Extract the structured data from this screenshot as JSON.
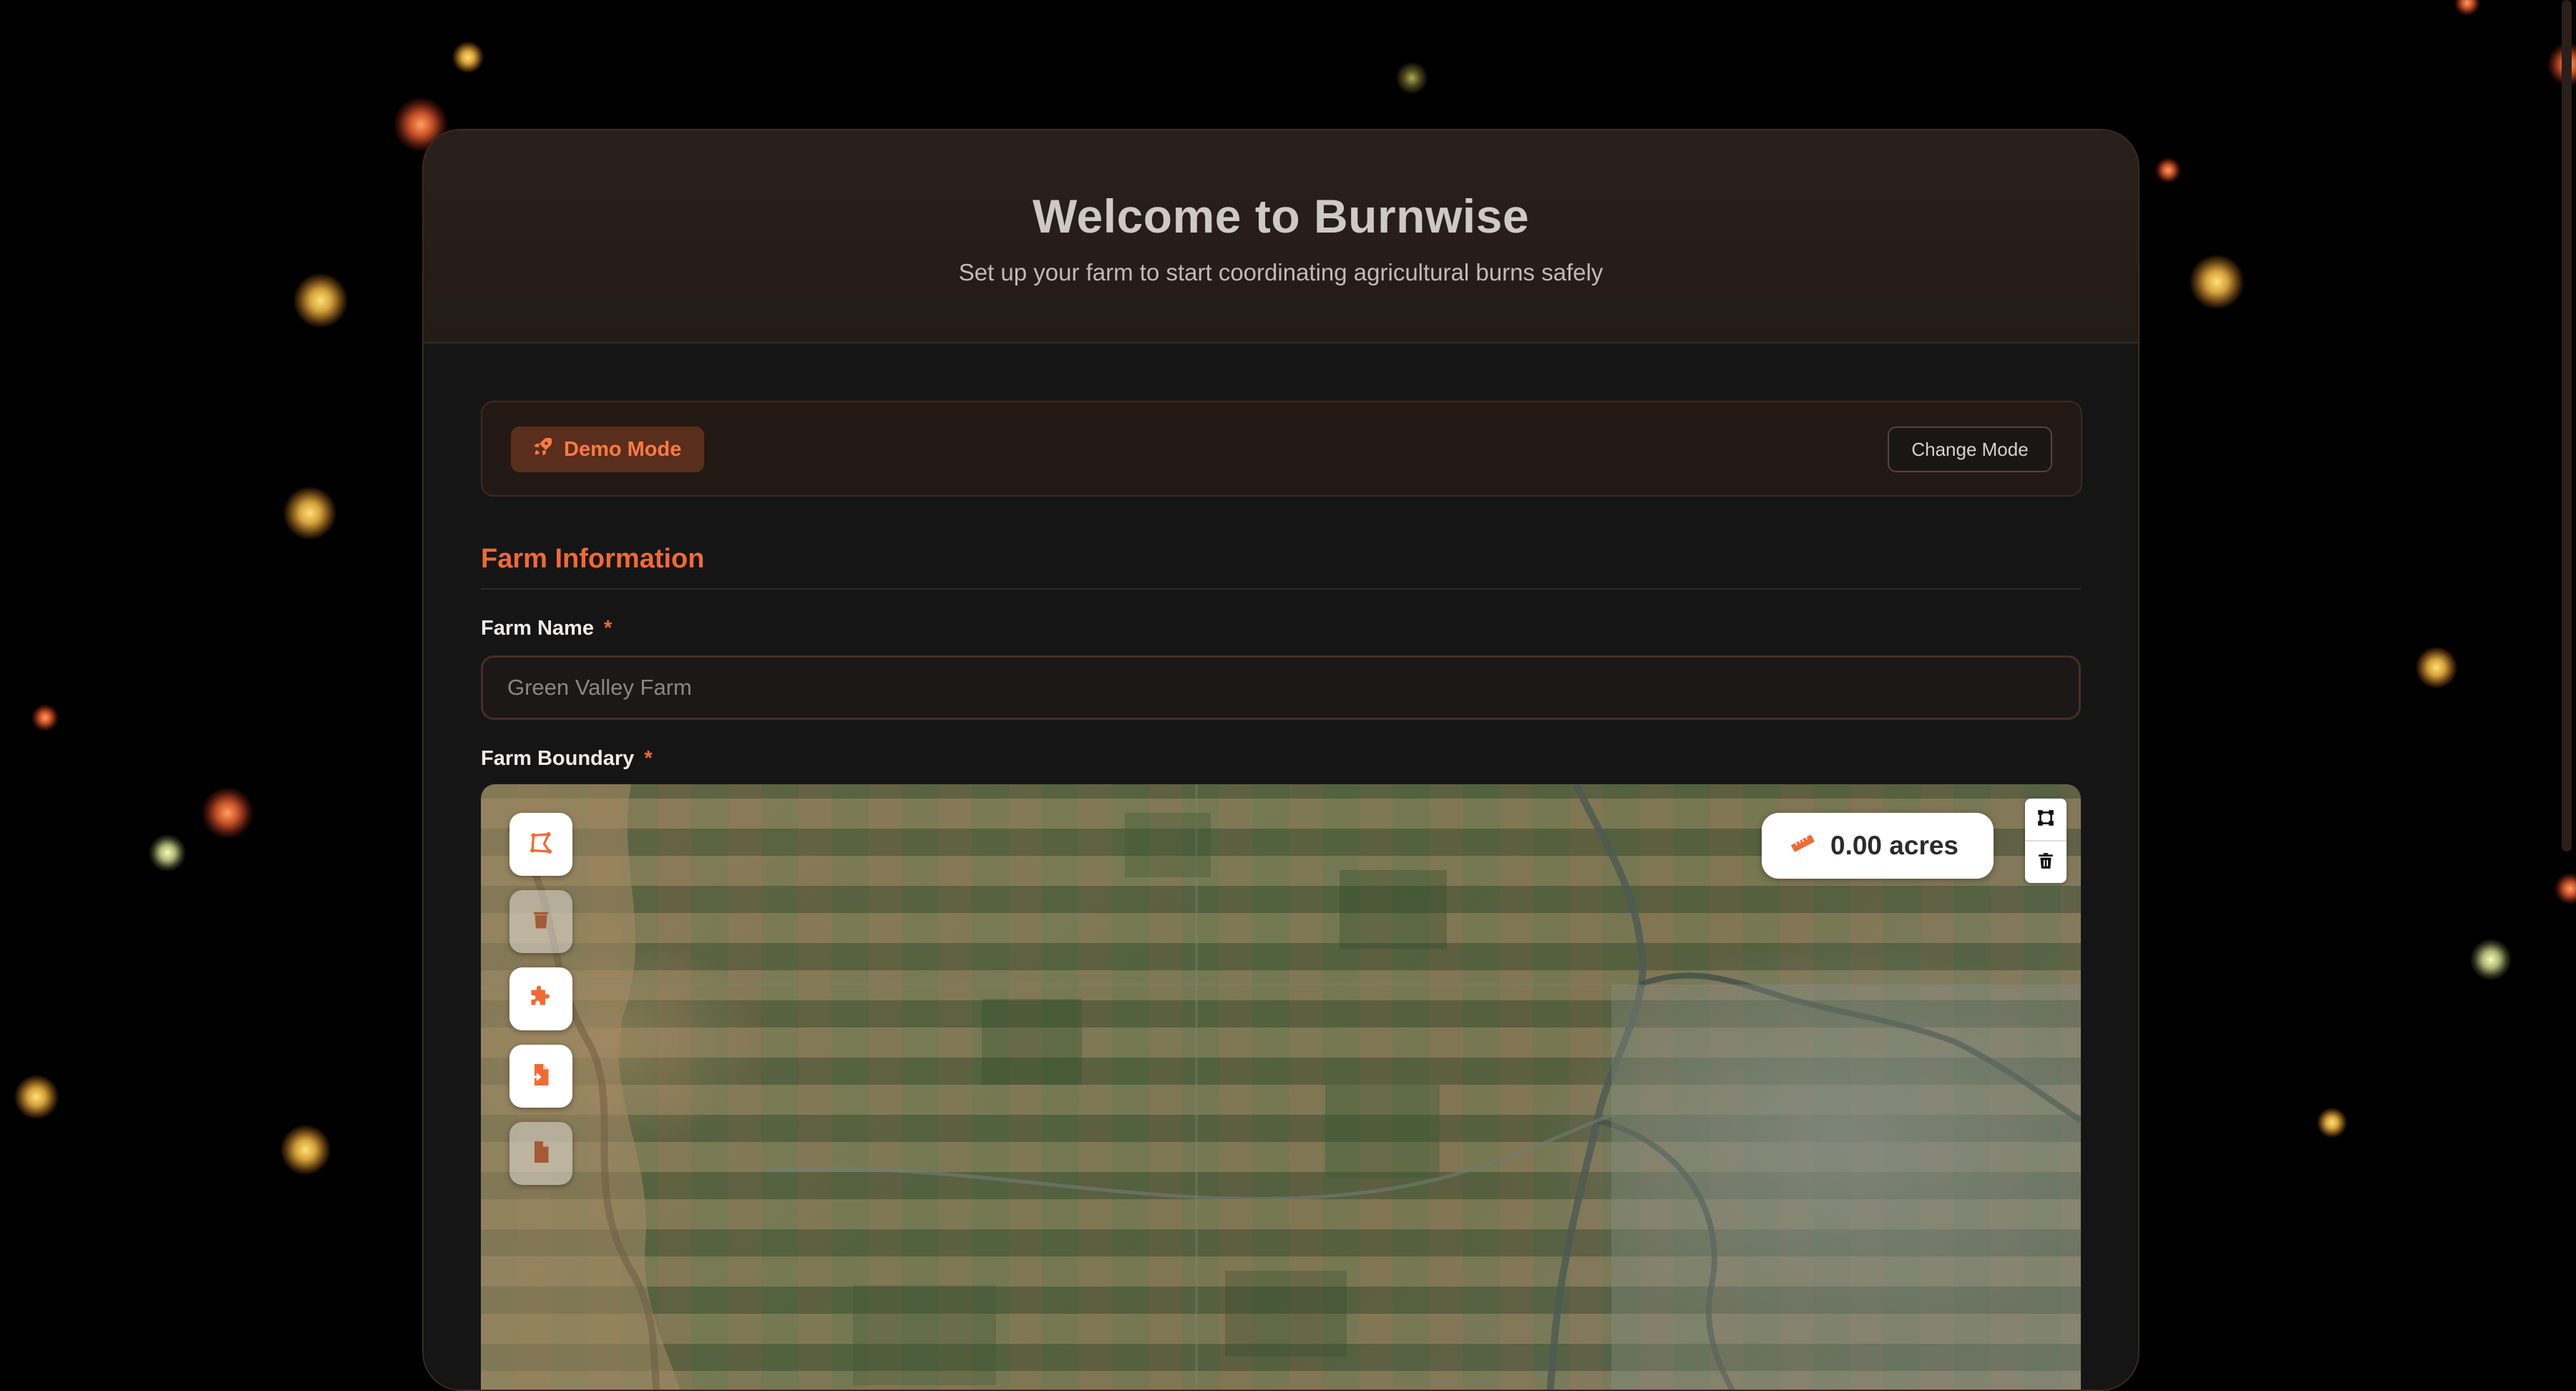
{
  "header": {
    "title": "Welcome to Burnwise",
    "subtitle": "Set up your farm to start coordinating agricultural burns safely"
  },
  "mode": {
    "badge_label": "Demo Mode",
    "badge_icon": "rocket-icon",
    "change_label": "Change Mode"
  },
  "section": {
    "title": "Farm Information"
  },
  "farm_name": {
    "label": "Farm Name",
    "required_mark": "*",
    "placeholder": "Green Valley Farm",
    "value": ""
  },
  "farm_boundary": {
    "label": "Farm Boundary",
    "required_mark": "*",
    "area_readout": "0.00 acres",
    "area_icon": "ruler-icon",
    "tools": [
      {
        "name": "draw-polygon-icon",
        "enabled": true
      },
      {
        "name": "delete-shape-icon",
        "enabled": false
      },
      {
        "name": "puzzle-icon",
        "enabled": true
      },
      {
        "name": "import-file-icon",
        "enabled": true
      },
      {
        "name": "export-file-icon",
        "enabled": false
      }
    ],
    "map_controls": [
      "draw-polygon-icon",
      "trash-icon"
    ]
  },
  "colors": {
    "accent": "#f26a33",
    "background": "#000000",
    "card": "#151515",
    "header": "#2a201b"
  }
}
